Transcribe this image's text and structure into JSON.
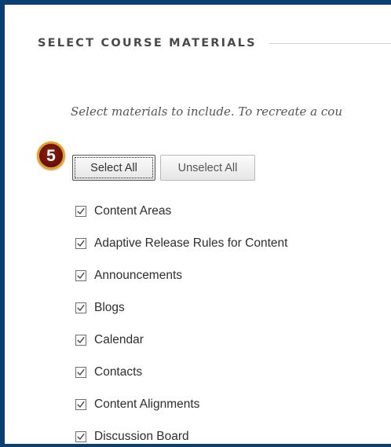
{
  "section": {
    "title": "SELECT COURSE MATERIALS",
    "instructions": "Select materials to include. To recreate a cou"
  },
  "step_badge": {
    "number": "5",
    "fill_color": "#6b120a",
    "ring_color": "#e0a21f"
  },
  "buttons": {
    "select_all": "Select All",
    "unselect_all": "Unselect All"
  },
  "materials": [
    {
      "label": "Content Areas",
      "checked": true
    },
    {
      "label": "Adaptive Release Rules for Content",
      "checked": true
    },
    {
      "label": "Announcements",
      "checked": true
    },
    {
      "label": "Blogs",
      "checked": true
    },
    {
      "label": "Calendar",
      "checked": true
    },
    {
      "label": "Contacts",
      "checked": true
    },
    {
      "label": "Content Alignments",
      "checked": true
    },
    {
      "label": "Discussion Board",
      "checked": true
    }
  ],
  "colors": {
    "frame_border": "#0b3f72",
    "checkmark": "#444444"
  }
}
